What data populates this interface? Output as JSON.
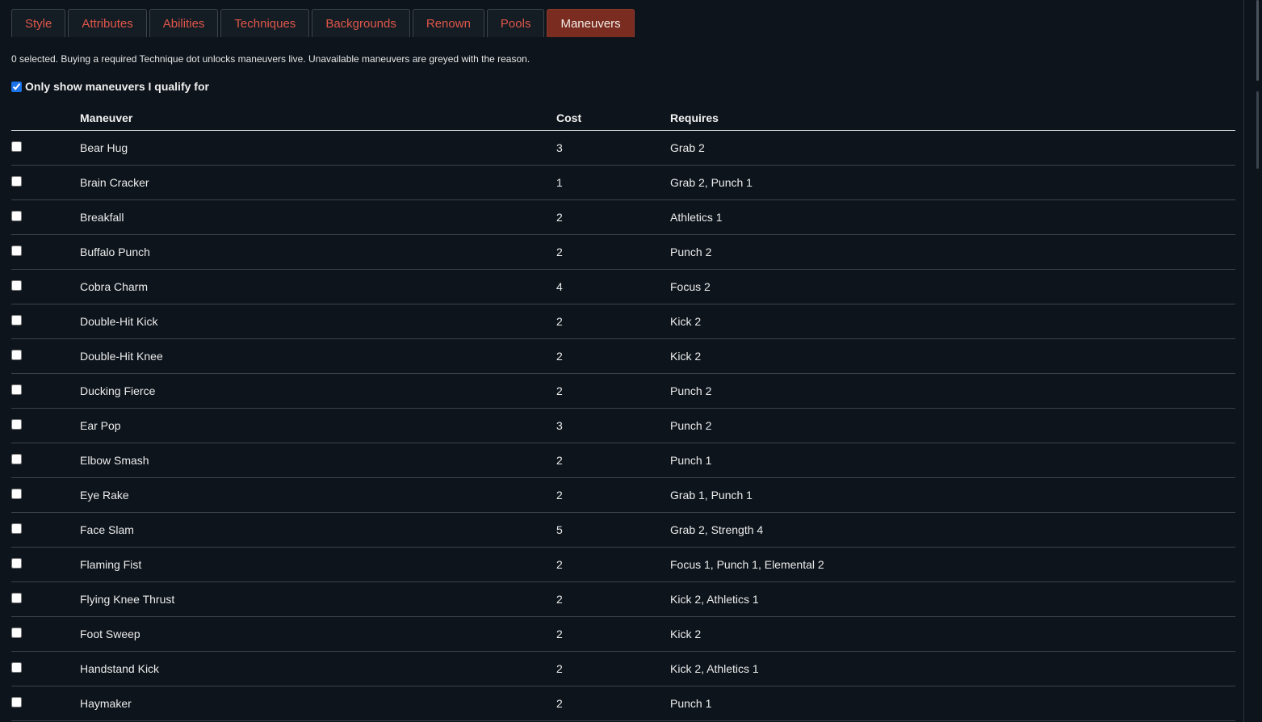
{
  "tabs": [
    {
      "label": "Style",
      "active": false
    },
    {
      "label": "Attributes",
      "active": false
    },
    {
      "label": "Abilities",
      "active": false
    },
    {
      "label": "Techniques",
      "active": false
    },
    {
      "label": "Backgrounds",
      "active": false
    },
    {
      "label": "Renown",
      "active": false
    },
    {
      "label": "Pools",
      "active": false
    },
    {
      "label": "Maneuvers",
      "active": true
    }
  ],
  "status_text": "0 selected. Buying a required Technique dot unlocks maneuvers live. Unavailable maneuvers are greyed with the reason.",
  "filter": {
    "label": "Only show maneuvers I qualify for",
    "checked": true
  },
  "table": {
    "columns": [
      "",
      "Maneuver",
      "Cost",
      "Requires"
    ],
    "rows": [
      {
        "name": "Bear Hug",
        "cost": "3",
        "requires": "Grab 2",
        "selected": false
      },
      {
        "name": "Brain Cracker",
        "cost": "1",
        "requires": "Grab 2, Punch 1",
        "selected": false
      },
      {
        "name": "Breakfall",
        "cost": "2",
        "requires": "Athletics 1",
        "selected": false
      },
      {
        "name": "Buffalo Punch",
        "cost": "2",
        "requires": "Punch 2",
        "selected": false
      },
      {
        "name": "Cobra Charm",
        "cost": "4",
        "requires": "Focus 2",
        "selected": false
      },
      {
        "name": "Double-Hit Kick",
        "cost": "2",
        "requires": "Kick 2",
        "selected": false
      },
      {
        "name": "Double-Hit Knee",
        "cost": "2",
        "requires": "Kick 2",
        "selected": false
      },
      {
        "name": "Ducking Fierce",
        "cost": "2",
        "requires": "Punch 2",
        "selected": false
      },
      {
        "name": "Ear Pop",
        "cost": "3",
        "requires": "Punch 2",
        "selected": false
      },
      {
        "name": "Elbow Smash",
        "cost": "2",
        "requires": "Punch 1",
        "selected": false
      },
      {
        "name": "Eye Rake",
        "cost": "2",
        "requires": "Grab 1, Punch 1",
        "selected": false
      },
      {
        "name": "Face Slam",
        "cost": "5",
        "requires": "Grab 2, Strength 4",
        "selected": false
      },
      {
        "name": "Flaming Fist",
        "cost": "2",
        "requires": "Focus 1, Punch 1, Elemental 2",
        "selected": false
      },
      {
        "name": "Flying Knee Thrust",
        "cost": "2",
        "requires": "Kick 2, Athletics 1",
        "selected": false
      },
      {
        "name": "Foot Sweep",
        "cost": "2",
        "requires": "Kick 2",
        "selected": false
      },
      {
        "name": "Handstand Kick",
        "cost": "2",
        "requires": "Kick 2, Athletics 1",
        "selected": false
      },
      {
        "name": "Haymaker",
        "cost": "2",
        "requires": "Punch 1",
        "selected": false
      }
    ]
  },
  "colors": {
    "background": "#0d141b",
    "tab_text": "#e0574a",
    "active_tab_bg": "#7a2c20",
    "requires_text": "#3c9a55"
  }
}
